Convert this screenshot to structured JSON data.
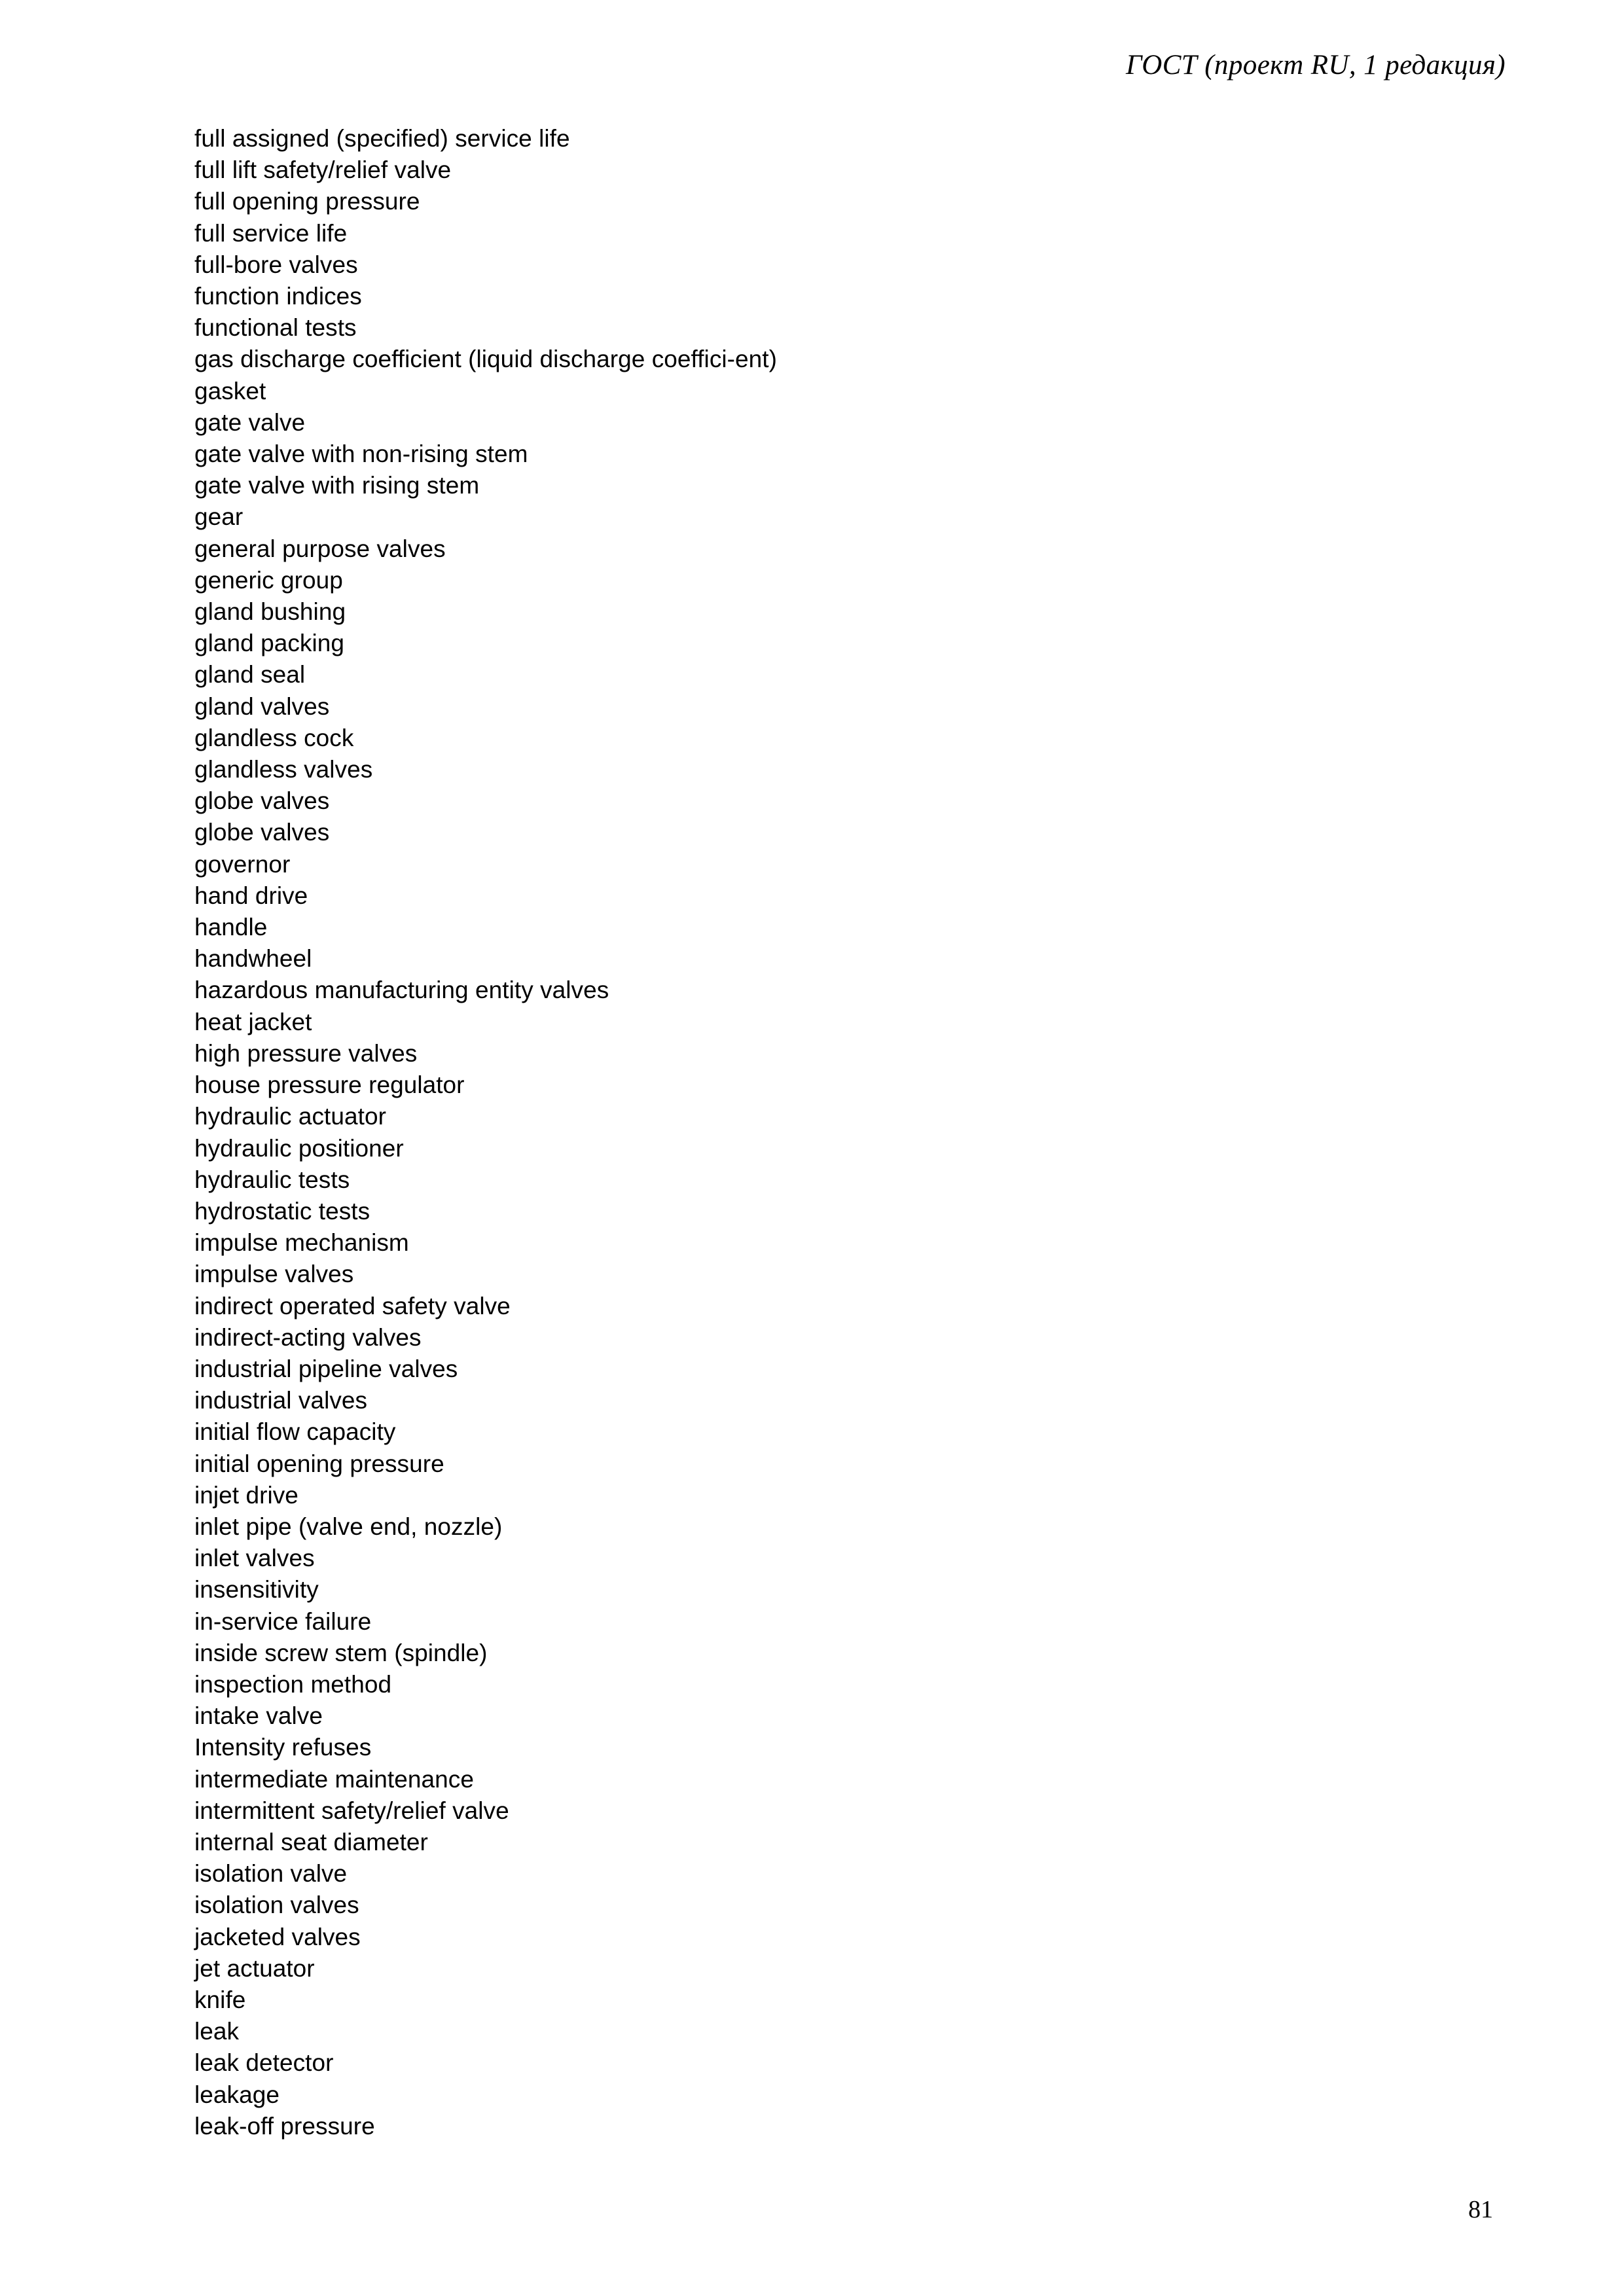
{
  "document": {
    "header_text": "ГОСТ  (проект RU, 1 редакция)",
    "page_number": "81",
    "text_color": "#000000",
    "background_color": "#ffffff"
  },
  "glossary": {
    "terms": [
      "full assigned (specified) service life",
      "full lift safety/relief valve",
      "full opening pressure",
      "full service life",
      "full-bore valves",
      "function indices",
      "functional tests",
      "gas discharge coefficient (liquid discharge coeffici-ent)",
      "gasket",
      "gate valve",
      "gate valve with non-rising stem",
      "gate valve with rising stem",
      "gear",
      "general purpose valves",
      "generic group",
      "gland bushing",
      "gland packing",
      "gland seal",
      "gland valves",
      "glandless cock",
      "glandless valves",
      "globe valves",
      "globe valves",
      "governor",
      "hand drive",
      "handle",
      "handwheel",
      "hazardous manufacturing entity valves",
      "heat jacket",
      "high pressure valves",
      "house pressure regulator",
      "hydraulic actuator",
      "hydraulic positioner",
      "hydraulic tests",
      "hydrostatic tests",
      "impulse mechanism",
      "impulse valves",
      "indirect operated safety valve",
      "indirect-acting valves",
      "industrial pipeline valves",
      "industrial valves",
      "initial flow capacity",
      "initial opening pressure",
      "injet drive",
      "inlet pipe (valve end, nozzle)",
      "inlet valves",
      "insensitivity",
      "in-service failure",
      "inside screw stem (spindle)",
      "inspection method",
      "intake valve",
      "Intensity refuses",
      "intermediate maintenance",
      "intermittent safety/relief valve",
      "internal seat diameter",
      "isolation valve",
      "isolation valves",
      "jacketed valves",
      "jet actuator",
      "knife",
      "leak",
      "leak detector",
      "leakage",
      "leak-off pressure"
    ]
  }
}
